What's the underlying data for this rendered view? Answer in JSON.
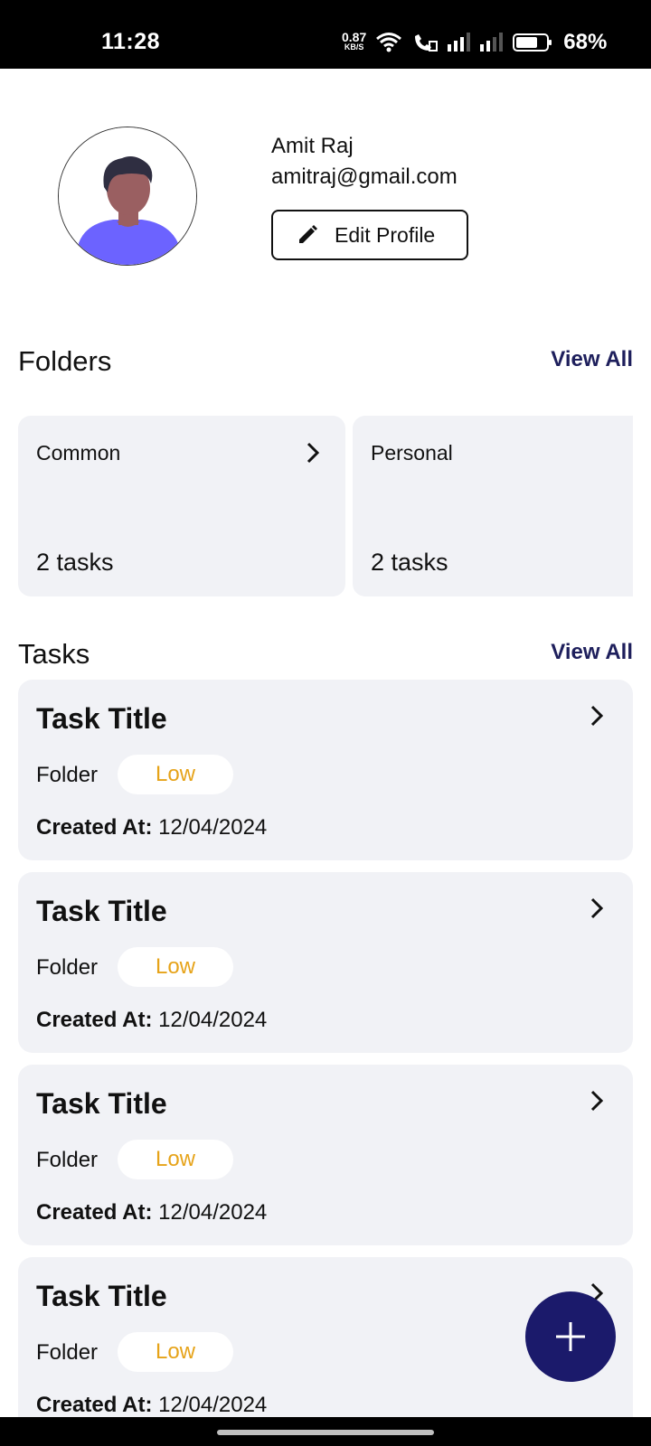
{
  "status_bar": {
    "time": "11:28",
    "net_speed_value": "0.87",
    "net_speed_unit": "KB/S",
    "battery_percent": "68%"
  },
  "profile": {
    "name": "Amit Raj",
    "email": "amitraj@gmail.com",
    "edit_label": "Edit Profile"
  },
  "folders_section": {
    "title": "Folders",
    "view_all": "View All",
    "items": [
      {
        "name": "Common",
        "count": "2 tasks"
      },
      {
        "name": "Personal",
        "count": "2 tasks"
      }
    ]
  },
  "tasks_section": {
    "title": "Tasks",
    "view_all": "View All",
    "items": [
      {
        "title": "Task Title",
        "folder": "Folder",
        "priority": "Low",
        "created_label": "Created At:",
        "created_value": "12/04/2024"
      },
      {
        "title": "Task Title",
        "folder": "Folder",
        "priority": "Low",
        "created_label": "Created At:",
        "created_value": "12/04/2024"
      },
      {
        "title": "Task Title",
        "folder": "Folder",
        "priority": "Low",
        "created_label": "Created At:",
        "created_value": "12/04/2024"
      },
      {
        "title": "Task Title",
        "folder": "Folder",
        "priority": "Low",
        "created_label": "Created At:",
        "created_value": "12/04/2024"
      }
    ]
  },
  "colors": {
    "accent": "#1e1f5c",
    "fab": "#1b1a6b",
    "card_bg": "#f1f2f6",
    "priority_low": "#e6a319"
  }
}
